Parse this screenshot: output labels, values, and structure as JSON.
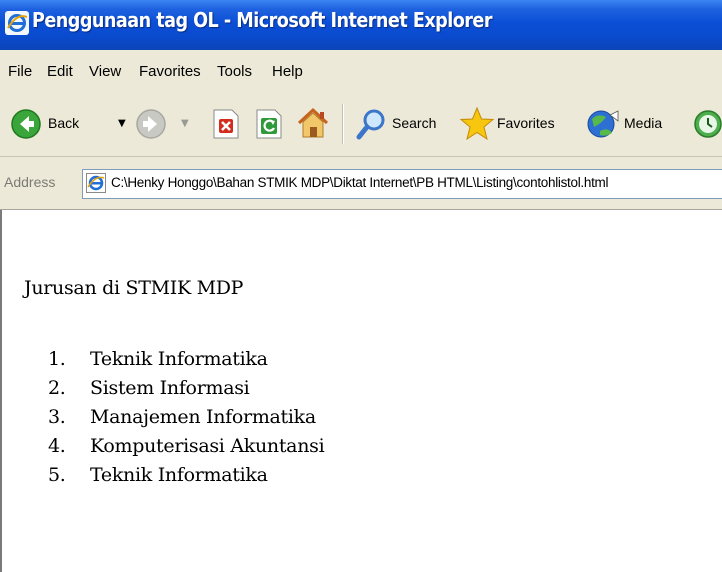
{
  "window": {
    "title": "Penggunaan tag OL - Microsoft Internet Explorer"
  },
  "menu": {
    "items": [
      "File",
      "Edit",
      "View",
      "Favorites",
      "Tools",
      "Help"
    ]
  },
  "toolbar": {
    "back_label": "Back",
    "search_label": "Search",
    "favorites_label": "Favorites",
    "media_label": "Media"
  },
  "address": {
    "label": "Address",
    "url": "C:\\Henky Honggo\\Bahan STMIK MDP\\Diktat Internet\\PB HTML\\Listing\\contohlistol.html"
  },
  "page": {
    "heading": "Jurusan di STMIK MDP",
    "list": [
      {
        "num": "1.",
        "text": "Teknik Informatika"
      },
      {
        "num": "2.",
        "text": "Sistem Informasi"
      },
      {
        "num": "3.",
        "text": "Manajemen Informatika"
      },
      {
        "num": "4.",
        "text": "Komputerisasi Akuntansi"
      },
      {
        "num": "5.",
        "text": "Teknik Informatika"
      }
    ]
  },
  "colors": {
    "titlebar": "#0b4fd6",
    "chrome": "#ece9d8",
    "back_green": "#3aa53a",
    "stop_red": "#d42c1c"
  }
}
